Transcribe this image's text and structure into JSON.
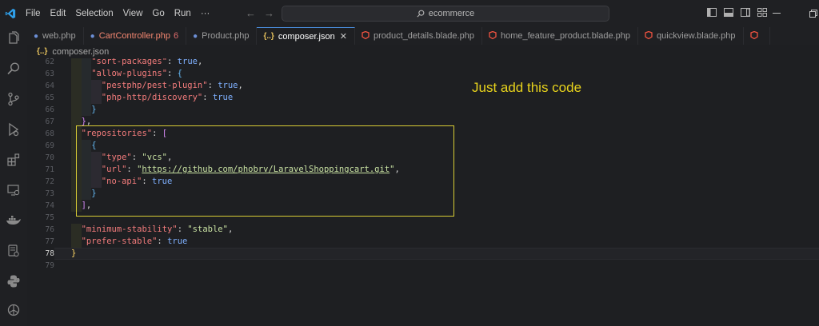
{
  "menu": [
    "File",
    "Edit",
    "Selection",
    "View",
    "Go",
    "Run",
    "···"
  ],
  "command_center": {
    "text": "ecommerce"
  },
  "tabs": [
    {
      "icon": "php-icon",
      "label": "web.php",
      "color": "#9d9d9d"
    },
    {
      "icon": "php-icon",
      "label": "CartController.php",
      "count": "6",
      "color": "#f48771"
    },
    {
      "icon": "php-icon",
      "label": "Product.php",
      "color": "#9d9d9d"
    },
    {
      "icon": "json-icon",
      "glyph": "{..}",
      "label": "composer.json",
      "active": true,
      "close": "✕"
    },
    {
      "icon": "laravel-icon",
      "label": "product_details.blade.php"
    },
    {
      "icon": "laravel-icon",
      "label": "home_feature_product.blade.php"
    },
    {
      "icon": "laravel-icon",
      "label": "quickview.blade.php"
    }
  ],
  "breadcrumb": {
    "glyph": "{..}",
    "file": "composer.json"
  },
  "editor": {
    "current_line": "78",
    "lines": [
      {
        "n": "62",
        "tokens": [
          [
            "k",
            "\"sort-packages\""
          ],
          [
            "p",
            ": "
          ],
          [
            "kw",
            "true"
          ],
          [
            "p",
            ","
          ]
        ]
      },
      {
        "n": "63",
        "tokens": [
          [
            "k",
            "\"allow-plugins\""
          ],
          [
            "p",
            ": "
          ],
          [
            "b3",
            "{"
          ]
        ]
      },
      {
        "n": "64",
        "tokens": [
          [
            "k",
            "\"pestphp/pest-plugin\""
          ],
          [
            "p",
            ": "
          ],
          [
            "kw",
            "true"
          ],
          [
            "p",
            ","
          ]
        ]
      },
      {
        "n": "65",
        "tokens": [
          [
            "k",
            "\"php-http/discovery\""
          ],
          [
            "p",
            ": "
          ],
          [
            "kw",
            "true"
          ]
        ]
      },
      {
        "n": "66",
        "tokens": [
          [
            "b3",
            "}"
          ]
        ]
      },
      {
        "n": "67",
        "tokens": [
          [
            "b2",
            "}"
          ],
          [
            "p",
            ","
          ]
        ]
      },
      {
        "n": "68",
        "tokens": [
          [
            "k",
            "\"repositories\""
          ],
          [
            "p",
            ": "
          ],
          [
            "b2",
            "["
          ]
        ]
      },
      {
        "n": "69",
        "tokens": [
          [
            "b3",
            "{"
          ]
        ]
      },
      {
        "n": "70",
        "tokens": [
          [
            "k",
            "\"type\""
          ],
          [
            "p",
            ": "
          ],
          [
            "s",
            "\"vcs\""
          ],
          [
            "p",
            ","
          ]
        ]
      },
      {
        "n": "71",
        "tokens": [
          [
            "k",
            "\"url\""
          ],
          [
            "p",
            ": "
          ],
          [
            "s",
            "\""
          ],
          [
            "url",
            "https://github.com/phobrv/LaravelShoppingcart.git"
          ],
          [
            "s",
            "\""
          ],
          [
            "p",
            ","
          ]
        ]
      },
      {
        "n": "72",
        "tokens": [
          [
            "k",
            "\"no-api\""
          ],
          [
            "p",
            ": "
          ],
          [
            "kw",
            "true"
          ]
        ]
      },
      {
        "n": "73",
        "tokens": [
          [
            "b3",
            "}"
          ]
        ]
      },
      {
        "n": "74",
        "tokens": [
          [
            "b2",
            "]"
          ],
          [
            "p",
            ","
          ]
        ]
      },
      {
        "n": "75",
        "tokens": []
      },
      {
        "n": "76",
        "tokens": [
          [
            "k",
            "\"minimum-stability\""
          ],
          [
            "p",
            ": "
          ],
          [
            "s",
            "\"stable\""
          ],
          [
            "p",
            ","
          ]
        ]
      },
      {
        "n": "77",
        "tokens": [
          [
            "k",
            "\"prefer-stable\""
          ],
          [
            "p",
            ": "
          ],
          [
            "kw",
            "true"
          ]
        ]
      },
      {
        "n": "78",
        "tokens": [
          [
            "b1",
            "}"
          ]
        ]
      },
      {
        "n": "79",
        "tokens": []
      }
    ]
  },
  "annotation": {
    "text": "Just add this code",
    "color": "#e8d31c"
  },
  "colors": {
    "accent": "#4b8fe0",
    "highlight_box": "#d8cc35"
  }
}
